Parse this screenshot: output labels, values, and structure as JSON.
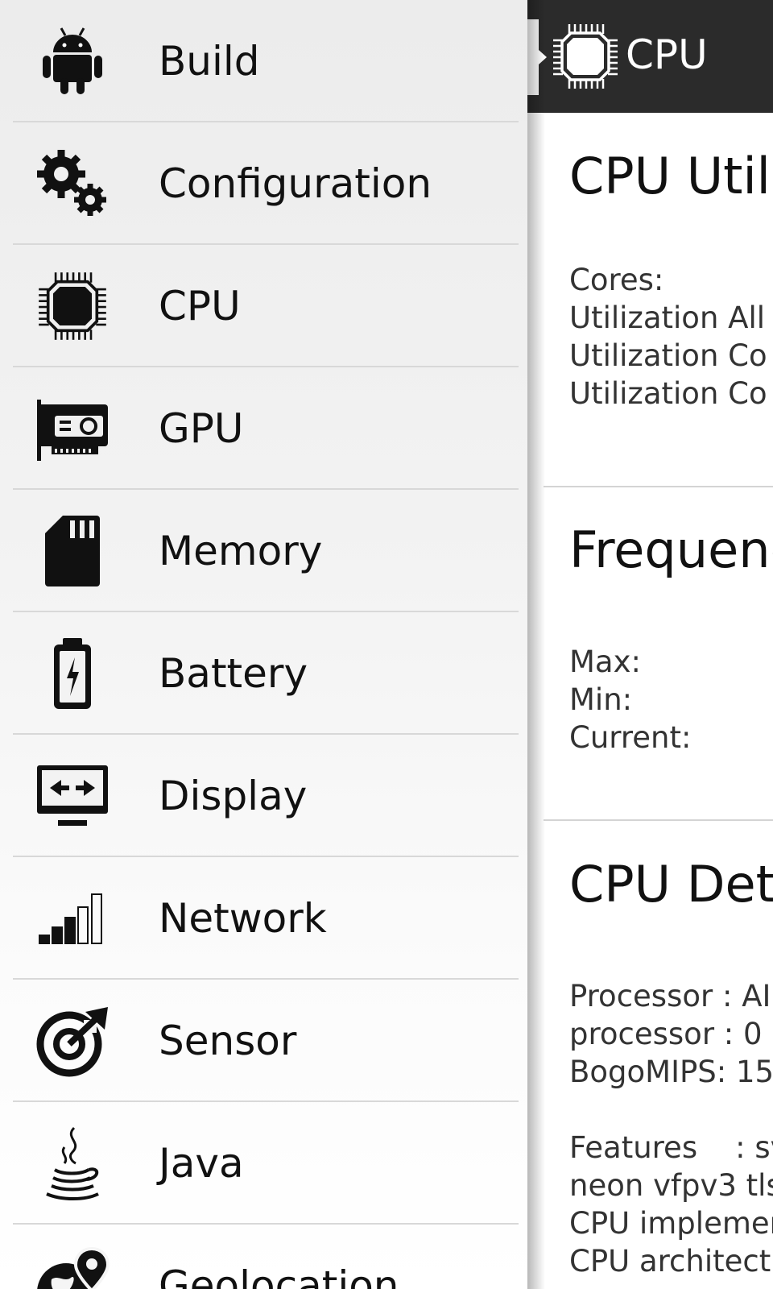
{
  "app_bar": {
    "title": "CPU",
    "icon": "cpu-chip-icon"
  },
  "content": {
    "utilization": {
      "title": "CPU Utili",
      "lines": [
        "Cores:",
        "Utilization All",
        "Utilization Co",
        "Utilization Co"
      ]
    },
    "frequency": {
      "title": "Frequenc",
      "lines": [
        "Max:",
        "Min:",
        "Current:"
      ]
    },
    "details": {
      "title": "CPU Deta",
      "lines": [
        "Processor : AI",
        "processor : 0",
        "BogoMIPS: 15"
      ],
      "lines2": [
        "Features    : sv",
        "neon vfpv3 tls",
        "CPU implemen",
        "CPU architect"
      ]
    }
  },
  "drawer": {
    "items": [
      {
        "label": "Build",
        "icon": "android-icon"
      },
      {
        "label": "Configuration",
        "icon": "gears-icon"
      },
      {
        "label": "CPU",
        "icon": "cpu-chip-icon"
      },
      {
        "label": "GPU",
        "icon": "graphics-card-icon"
      },
      {
        "label": "Memory",
        "icon": "sd-card-icon"
      },
      {
        "label": "Battery",
        "icon": "battery-charging-icon"
      },
      {
        "label": "Display",
        "icon": "monitor-icon"
      },
      {
        "label": "Network",
        "icon": "signal-bars-icon"
      },
      {
        "label": "Sensor",
        "icon": "sensor-target-icon"
      },
      {
        "label": "Java",
        "icon": "java-cup-icon"
      },
      {
        "label": "Geolocation",
        "icon": "globe-pin-icon"
      }
    ]
  }
}
